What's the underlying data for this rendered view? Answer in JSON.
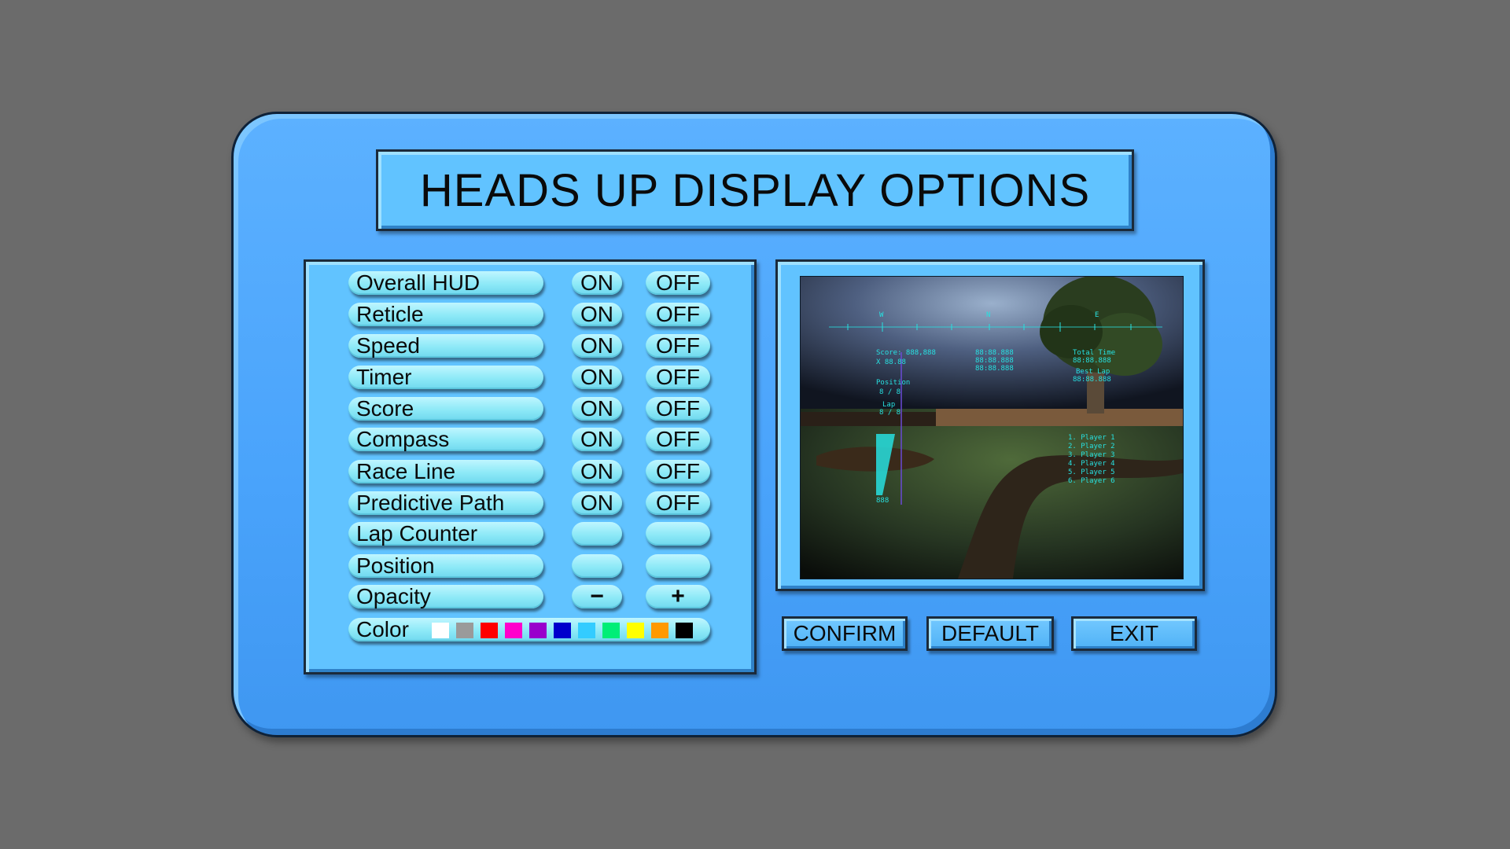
{
  "title": "HEADS UP DISPLAY OPTIONS",
  "options": [
    {
      "label": "Overall HUD",
      "on": "ON",
      "off": "OFF"
    },
    {
      "label": "Reticle",
      "on": "ON",
      "off": "OFF"
    },
    {
      "label": "Speed",
      "on": "ON",
      "off": "OFF"
    },
    {
      "label": "Timer",
      "on": "ON",
      "off": "OFF"
    },
    {
      "label": "Score",
      "on": "ON",
      "off": "OFF"
    },
    {
      "label": "Compass",
      "on": "ON",
      "off": "OFF"
    },
    {
      "label": "Race Line",
      "on": "ON",
      "off": "OFF"
    },
    {
      "label": "Predictive Path",
      "on": "ON",
      "off": "OFF"
    },
    {
      "label": "Lap Counter",
      "on": "",
      "off": ""
    },
    {
      "label": "Position",
      "on": "",
      "off": ""
    }
  ],
  "opacity": {
    "label": "Opacity",
    "minus": "−",
    "plus": "+"
  },
  "color": {
    "label": "Color",
    "swatches": [
      "#ffffff",
      "#9a9a9a",
      "#ff0000",
      "#ff00cc",
      "#9900cc",
      "#0000cc",
      "#33ccff",
      "#00ee77",
      "#ffff00",
      "#ff9900",
      "#000000"
    ]
  },
  "preview": {
    "compass": [
      "W",
      "N",
      "E"
    ],
    "score": "Score: 888,888",
    "multiplier": "X 88.88",
    "position_label": "Position",
    "position_value": "8 / 8",
    "lap_label": "Lap",
    "lap_value": "8 / 8",
    "timer_lines": [
      "88:88.888",
      "88:88.888",
      "88:88.888"
    ],
    "total_time_label": "Total Time",
    "total_time_value": "88:88.888",
    "best_lap_label": "Best Lap",
    "best_lap_value": "88:88.888",
    "speed_value": "888",
    "standings": [
      "1. Player 1",
      "2. Player 2",
      "3. Player 3",
      "4. Player 4",
      "5. Player 5",
      "6. Player 6"
    ]
  },
  "buttons": {
    "confirm": "CONFIRM",
    "default": "DEFAULT",
    "exit": "EXIT"
  },
  "colors": {
    "panel": "#4aa5fb",
    "box": "#61c3ff",
    "pill": "#8de9f7",
    "hud": "#27e0e0"
  }
}
